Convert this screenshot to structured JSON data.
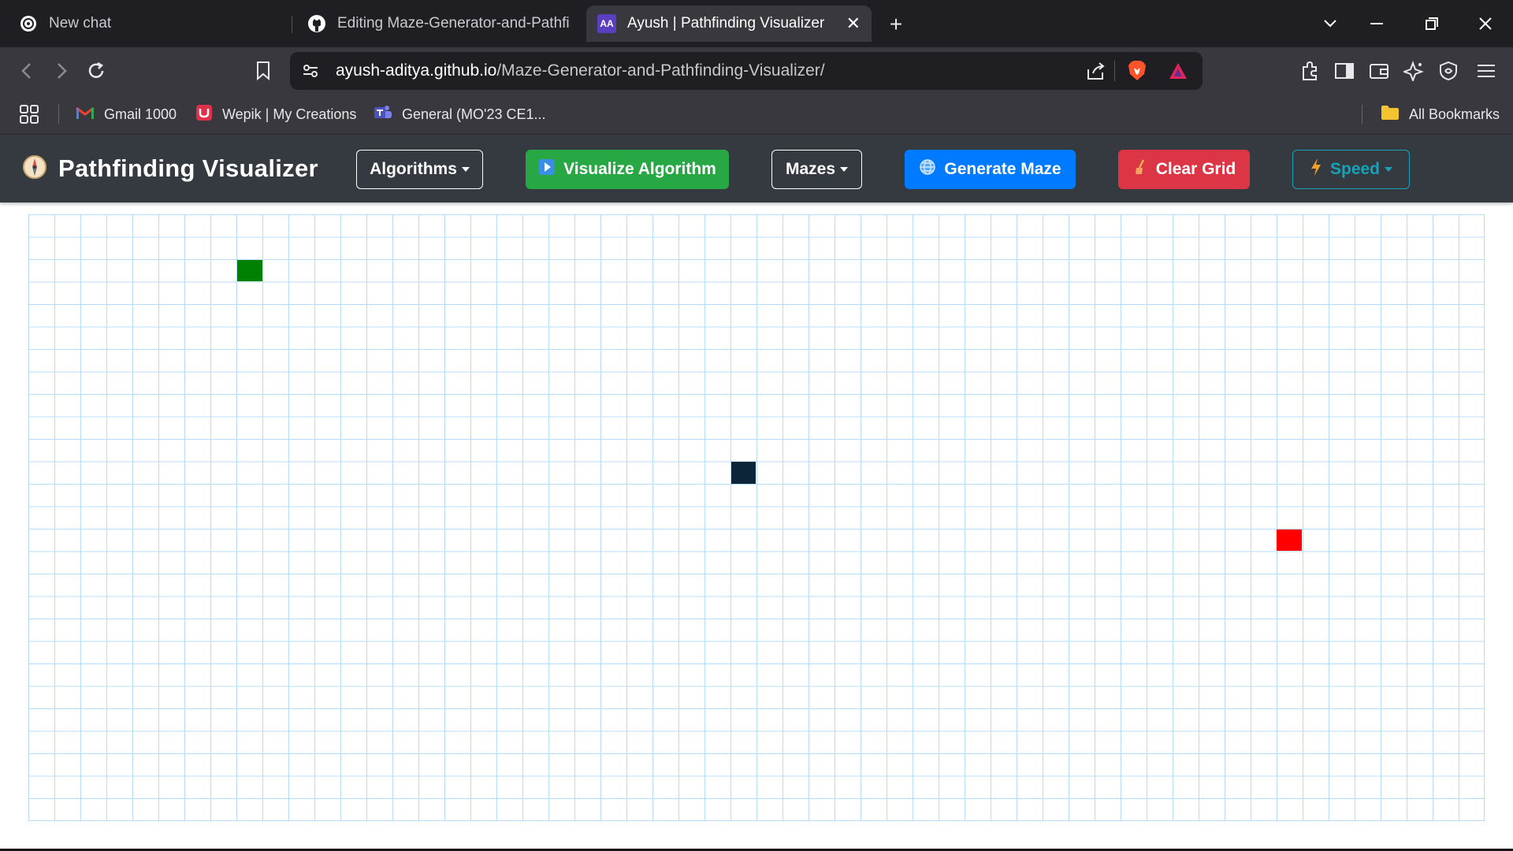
{
  "browser": {
    "tabs": [
      {
        "title": "New chat",
        "icon": "openai-icon",
        "active": false
      },
      {
        "title": "Editing Maze-Generator-and-Pathfinc",
        "icon": "github-icon",
        "active": false
      },
      {
        "title": "Ayush | Pathfinding Visualizer",
        "icon": "aa-favicon",
        "favicon_text": "AA",
        "active": true
      }
    ],
    "url_host": "ayush-aditya.github.io",
    "url_path": "/Maze-Generator-and-Pathfinding-Visualizer/",
    "bookmarks": [
      {
        "label": "Gmail 1000",
        "icon": "gmail-icon"
      },
      {
        "label": "Wepik | My Creations",
        "icon": "wepik-icon"
      },
      {
        "label": "General (MO'23 CE1...",
        "icon": "teams-icon"
      }
    ],
    "all_bookmarks_label": "All Bookmarks"
  },
  "app": {
    "title": "Pathfinding Visualizer",
    "buttons": {
      "algorithms": "Algorithms",
      "visualize": "Visualize Algorithm",
      "mazes": "Mazes",
      "generate": "Generate Maze",
      "clear": "Clear Grid",
      "speed": "Speed"
    },
    "colors": {
      "navbar": "#343a40",
      "success": "#28a745",
      "primary": "#007bff",
      "danger": "#dc3545",
      "info": "#17a2b8",
      "grid_line": "#b9dcf6",
      "start": "#008000",
      "end": "#ff0000",
      "wall": "#0c2538"
    },
    "grid": {
      "columns": 56,
      "rows": 27,
      "start_node": {
        "col": 8,
        "row": 2
      },
      "end_node": {
        "col": 48,
        "row": 14
      },
      "wall_nodes": [
        {
          "col": 27,
          "row": 11
        }
      ]
    }
  }
}
